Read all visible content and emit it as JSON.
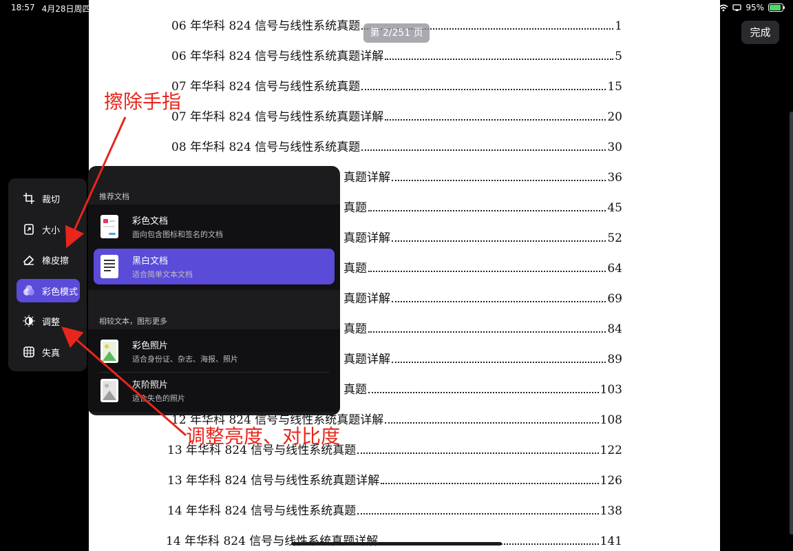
{
  "status": {
    "time": "18:57",
    "date": "4月28日周四",
    "battery": "95%",
    "battery_level": 0.95
  },
  "page_indicator": "第 2/251 页",
  "done_label": "完成",
  "toc": [
    {
      "title": "06 年华科 824 信号与线性系统真题",
      "page": "1"
    },
    {
      "title": "06 年华科 824 信号与线性系统真题详解",
      "page": "5"
    },
    {
      "title": "07 年华科 824 信号与线性系统真题",
      "page": "15"
    },
    {
      "title": "07 年华科 824 信号与线性系统真题详解",
      "page": "20"
    },
    {
      "title": "08 年华科 824 信号与线性系统真题",
      "page": "30"
    },
    {
      "title": "真题详解",
      "page": "36"
    },
    {
      "title": "真题",
      "page": "45"
    },
    {
      "title": "真题详解",
      "page": "52"
    },
    {
      "title": "真题",
      "page": "64"
    },
    {
      "title": "真题详解",
      "page": "69"
    },
    {
      "title": "真题",
      "page": "84"
    },
    {
      "title": "真题详解",
      "page": "89"
    },
    {
      "title": "真题",
      "page": "103"
    },
    {
      "title": "12 年华科 824 信号与线性系统真题详解",
      "page": "108"
    },
    {
      "title": "13 年华科 824 信号与线性系统真题",
      "page": "122"
    },
    {
      "title": "13 年华科 824 信号与线性系统真题详解",
      "page": "126"
    },
    {
      "title": "14 年华科 824 信号与线性系统真题",
      "page": "138"
    },
    {
      "title": "14 年华科 824 信号与线性系统真题详解",
      "page": "141"
    }
  ],
  "tools": [
    {
      "label": "裁切",
      "icon": "crop-icon"
    },
    {
      "label": "大小",
      "icon": "resize-icon"
    },
    {
      "label": "橡皮擦",
      "icon": "eraser-icon"
    },
    {
      "label": "彩色模式",
      "icon": "color-mode-icon",
      "active": true
    },
    {
      "label": "调整",
      "icon": "adjust-icon"
    },
    {
      "label": "失真",
      "icon": "distortion-icon"
    }
  ],
  "popup": {
    "section1_title": "推荐文档",
    "section2_title": "相较文本，图形更多",
    "options": [
      {
        "title": "彩色文档",
        "subtitle": "面向包含图标和签名的文档"
      },
      {
        "title": "黑白文档",
        "subtitle": "适合简单文本文档",
        "selected": true
      },
      {
        "title": "彩色照片",
        "subtitle": "适合身份证、杂志、海报、照片"
      },
      {
        "title": "灰阶照片",
        "subtitle": "适合失色的照片"
      }
    ]
  },
  "annotations": {
    "eraser_note": "擦除手指",
    "adjust_note": "调整亮度、对比度"
  },
  "colors": {
    "accent": "#5b4bd9",
    "annotation": "#e8261c",
    "panel": "#1c1c1e"
  }
}
